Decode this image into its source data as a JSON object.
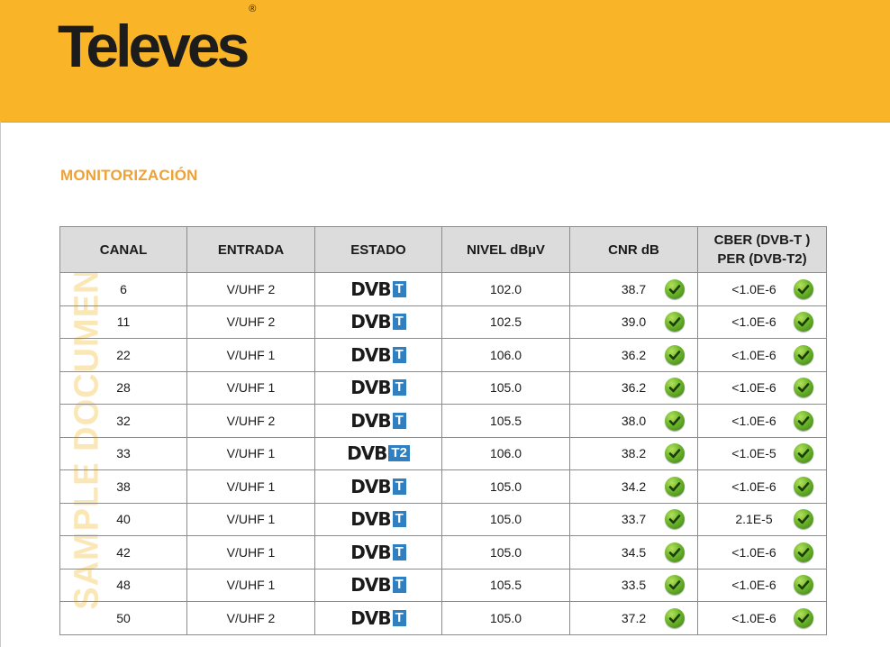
{
  "brand": {
    "name": "Televes",
    "mark": "®"
  },
  "section_title": "MONITORIZACIÓN",
  "watermark": "SAMPLE DOCUMENT",
  "table": {
    "headers": {
      "canal": "CANAL",
      "entrada": "ENTRADA",
      "estado": "ESTADO",
      "nivel": "NIVEL dBµV",
      "cnr": "CNR dB",
      "cber_line1": "CBER (DVB-T )",
      "cber_line2": "PER (DVB-T2)"
    },
    "rows": [
      {
        "canal": "6",
        "entrada": "V/UHF 2",
        "estado_logo": "DVB",
        "estado_badge": "T",
        "nivel": "102.0",
        "cnr": "38.7",
        "cber": "<1.0E-6"
      },
      {
        "canal": "11",
        "entrada": "V/UHF 2",
        "estado_logo": "DVB",
        "estado_badge": "T",
        "nivel": "102.5",
        "cnr": "39.0",
        "cber": "<1.0E-6"
      },
      {
        "canal": "22",
        "entrada": "V/UHF 1",
        "estado_logo": "DVB",
        "estado_badge": "T",
        "nivel": "106.0",
        "cnr": "36.2",
        "cber": "<1.0E-6"
      },
      {
        "canal": "28",
        "entrada": "V/UHF 1",
        "estado_logo": "DVB",
        "estado_badge": "T",
        "nivel": "105.0",
        "cnr": "36.2",
        "cber": "<1.0E-6"
      },
      {
        "canal": "32",
        "entrada": "V/UHF 2",
        "estado_logo": "DVB",
        "estado_badge": "T",
        "nivel": "105.5",
        "cnr": "38.0",
        "cber": "<1.0E-6"
      },
      {
        "canal": "33",
        "entrada": "V/UHF 1",
        "estado_logo": "DVB",
        "estado_badge": "T2",
        "nivel": "106.0",
        "cnr": "38.2",
        "cber": "<1.0E-5"
      },
      {
        "canal": "38",
        "entrada": "V/UHF 1",
        "estado_logo": "DVB",
        "estado_badge": "T",
        "nivel": "105.0",
        "cnr": "34.2",
        "cber": "<1.0E-6"
      },
      {
        "canal": "40",
        "entrada": "V/UHF 1",
        "estado_logo": "DVB",
        "estado_badge": "T",
        "nivel": "105.0",
        "cnr": "33.7",
        "cber": "2.1E-5"
      },
      {
        "canal": "42",
        "entrada": "V/UHF 1",
        "estado_logo": "DVB",
        "estado_badge": "T",
        "nivel": "105.0",
        "cnr": "34.5",
        "cber": "<1.0E-6"
      },
      {
        "canal": "48",
        "entrada": "V/UHF 1",
        "estado_logo": "DVB",
        "estado_badge": "T",
        "nivel": "105.5",
        "cnr": "33.5",
        "cber": "<1.0E-6"
      },
      {
        "canal": "50",
        "entrada": "V/UHF 2",
        "estado_logo": "DVB",
        "estado_badge": "T",
        "nivel": "105.0",
        "cnr": "37.2",
        "cber": "<1.0E-6"
      }
    ]
  },
  "icons": {
    "status_ok": "check-circle-icon"
  },
  "colors": {
    "header": "#f9b428",
    "section_title": "#eea135",
    "badge": "#2f7fc1",
    "check": "#6cb52c"
  }
}
